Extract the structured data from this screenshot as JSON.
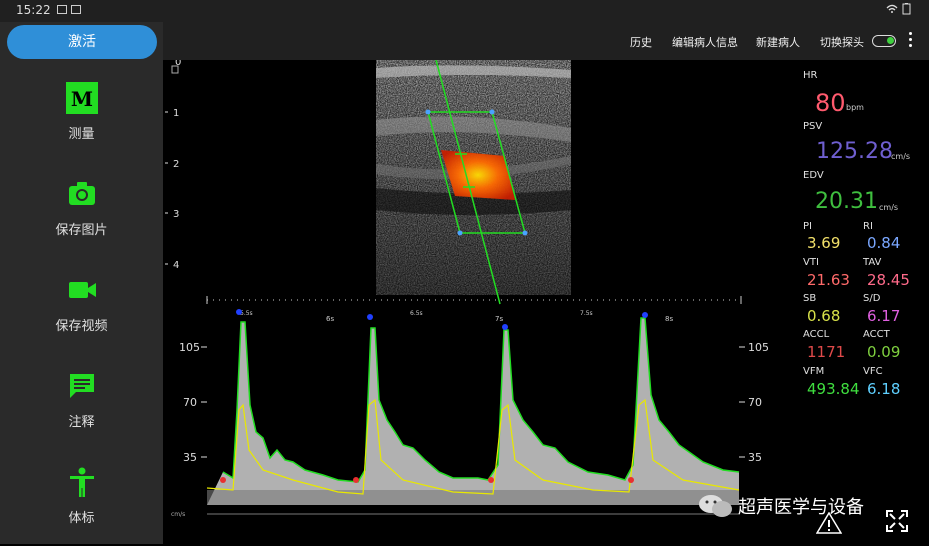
{
  "status": {
    "time": "15:22"
  },
  "sidebar": {
    "activate_label": "激活",
    "items": [
      {
        "icon": "m-mode-icon",
        "glyph": "M",
        "label": "测量"
      },
      {
        "icon": "camera-icon",
        "label": "保存图片"
      },
      {
        "icon": "video-icon",
        "label": "保存视频"
      },
      {
        "icon": "annotation-icon",
        "label": "注释"
      },
      {
        "icon": "body-mark-icon",
        "label": "体标"
      }
    ]
  },
  "toolbar": {
    "history": "历史",
    "edit_patient": "编辑病人信息",
    "new_patient": "新建病人",
    "switch_probe": "切换探头"
  },
  "depth_scale": {
    "labels": [
      "0",
      "1",
      "2",
      "3",
      "4"
    ]
  },
  "doppler": {
    "time_labels": [
      "5.5s",
      "6s",
      "6.5s",
      "7s",
      "7.5s",
      "8s"
    ],
    "velocity_labels": [
      "105",
      "70",
      "35"
    ],
    "baseline_label": "cm/s"
  },
  "measurements": {
    "hr": {
      "label": "HR",
      "value": "80",
      "unit": "bpm"
    },
    "psv": {
      "label": "PSV",
      "value": "125.28",
      "unit": "cm/s"
    },
    "edv": {
      "label": "EDV",
      "value": "20.31",
      "unit": "cm/s"
    },
    "pi": {
      "label": "PI",
      "value": "3.69"
    },
    "ri": {
      "label": "RI",
      "value": "0.84"
    },
    "vti": {
      "label": "VTI",
      "value": "21.63"
    },
    "tav": {
      "label": "TAV",
      "value": "28.45"
    },
    "sb": {
      "label": "SB",
      "value": "0.68"
    },
    "sd": {
      "label": "S/D",
      "value": "6.17"
    },
    "accl": {
      "label": "ACCL",
      "value": "1171"
    },
    "acct": {
      "label": "ACCT",
      "value": "0.09"
    },
    "vfm": {
      "label": "VFM",
      "value": "493.84"
    },
    "vfc": {
      "label": "VFC",
      "value": "6.18"
    }
  },
  "colors": {
    "accent_green": "#22dd22",
    "activate_blue": "#2f8fd8",
    "hr": "#ff5a6e",
    "psv": "#6f5fd0",
    "edv": "#3fbf3f",
    "pi": "#f2e06a",
    "ri": "#7aa7ff",
    "vti": "#ff6a6a",
    "tav": "#ff6a8a",
    "sb": "#d8e24a",
    "sd": "#e060e0",
    "accl": "#e04a4a",
    "acct": "#7fd03f",
    "vfm": "#3fdf3f",
    "vfc": "#5fd0ff"
  },
  "watermark": {
    "text": "超声医学与设备"
  }
}
